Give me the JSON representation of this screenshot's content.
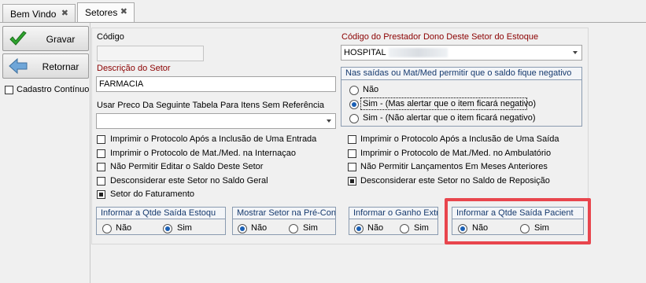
{
  "tabs": [
    {
      "label": "Bem Vindo",
      "close": "✖"
    },
    {
      "label": "Setores",
      "close": "✖"
    }
  ],
  "toolbar": {
    "save_label": "Gravar",
    "back_label": "Retornar",
    "continuous_label": "Cadastro Contínuo"
  },
  "form": {
    "codigo_label": "Código",
    "codigo_value": "",
    "descricao_label": "Descrição do Setor",
    "descricao_value": "FARMACIA",
    "tabela_label": "Usar Preco Da Seguinte Tabela Para Itens Sem Referência",
    "tabela_value": "",
    "prestador_label": "Código do Prestador Dono Deste Setor do Estoque",
    "prestador_value": "HOSPITAL"
  },
  "saldo_group": {
    "title": "Nas saídas ou Mat/Med permitir que o saldo fique negativo",
    "options": [
      "Não",
      "Sim - (Mas alertar que o item ficará negativo)",
      "Sim - (Não alertar que o item ficará negativo)"
    ],
    "selected": 1
  },
  "checks_left": [
    {
      "label": "Imprimir o Protocolo Após a Inclusão de Uma Entrada",
      "checked": false
    },
    {
      "label": "Imprimir o Protocolo de Mat./Med. na Internaçao",
      "checked": false
    },
    {
      "label": "Não Permitir Editar o Saldo Deste Setor",
      "checked": false
    },
    {
      "label": "Desconsiderar este Setor no Saldo Geral",
      "checked": false
    },
    {
      "label": "Setor do Faturamento",
      "checked": true
    }
  ],
  "checks_right": [
    {
      "label": "Imprimir o Protocolo Após a Inclusão de Uma Saída",
      "checked": false
    },
    {
      "label": "Imprimir o Protocolo de Mat./Med. no Ambulatório",
      "checked": false
    },
    {
      "label": "Não Permitir Lançamentos Em Meses Anteriores",
      "checked": false
    },
    {
      "label": "Desconsiderar este Setor no Saldo de Reposição",
      "checked": true
    }
  ],
  "option_groups": [
    {
      "title": "Informar a Qtde Saída Estoqu",
      "no": "Não",
      "yes": "Sim",
      "selected": "yes"
    },
    {
      "title": "Mostrar Setor na Pré-Con",
      "no": "Não",
      "yes": "Sim",
      "selected": "no"
    },
    {
      "title": "Informar o Ganho Extr",
      "no": "Não",
      "yes": "Sim",
      "selected": "no"
    },
    {
      "title": "Informar a Qtde Saída Pacient",
      "no": "Não",
      "yes": "Sim",
      "selected": "no"
    }
  ],
  "colors": {
    "highlight": "#e8454d",
    "label_red": "#8b0000",
    "group_title": "#163a6e"
  }
}
